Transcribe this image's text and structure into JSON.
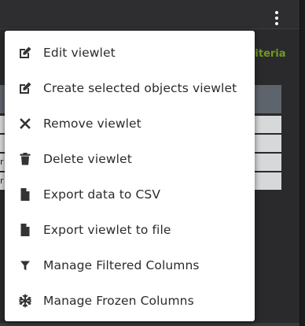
{
  "background": {
    "criteria_text": "riteria",
    "row_fragments": [
      "",
      "",
      "r",
      "r"
    ]
  },
  "menu": {
    "items": [
      {
        "label": "Edit viewlet",
        "icon": "edit-icon"
      },
      {
        "label": "Create selected objects viewlet",
        "icon": "edit-icon"
      },
      {
        "label": "Remove viewlet",
        "icon": "close-icon"
      },
      {
        "label": "Delete viewlet",
        "icon": "trash-icon"
      },
      {
        "label": "Export data to CSV",
        "icon": "file-icon"
      },
      {
        "label": "Export viewlet to file",
        "icon": "file-icon"
      },
      {
        "label": "Manage Filtered Columns",
        "icon": "filter-icon"
      },
      {
        "label": "Manage Frozen Columns",
        "icon": "snowflake-icon"
      }
    ]
  },
  "colors": {
    "menu_text": "#2b2b2b",
    "accent_green": "#6f9b1f",
    "table_header": "#5e646b"
  }
}
